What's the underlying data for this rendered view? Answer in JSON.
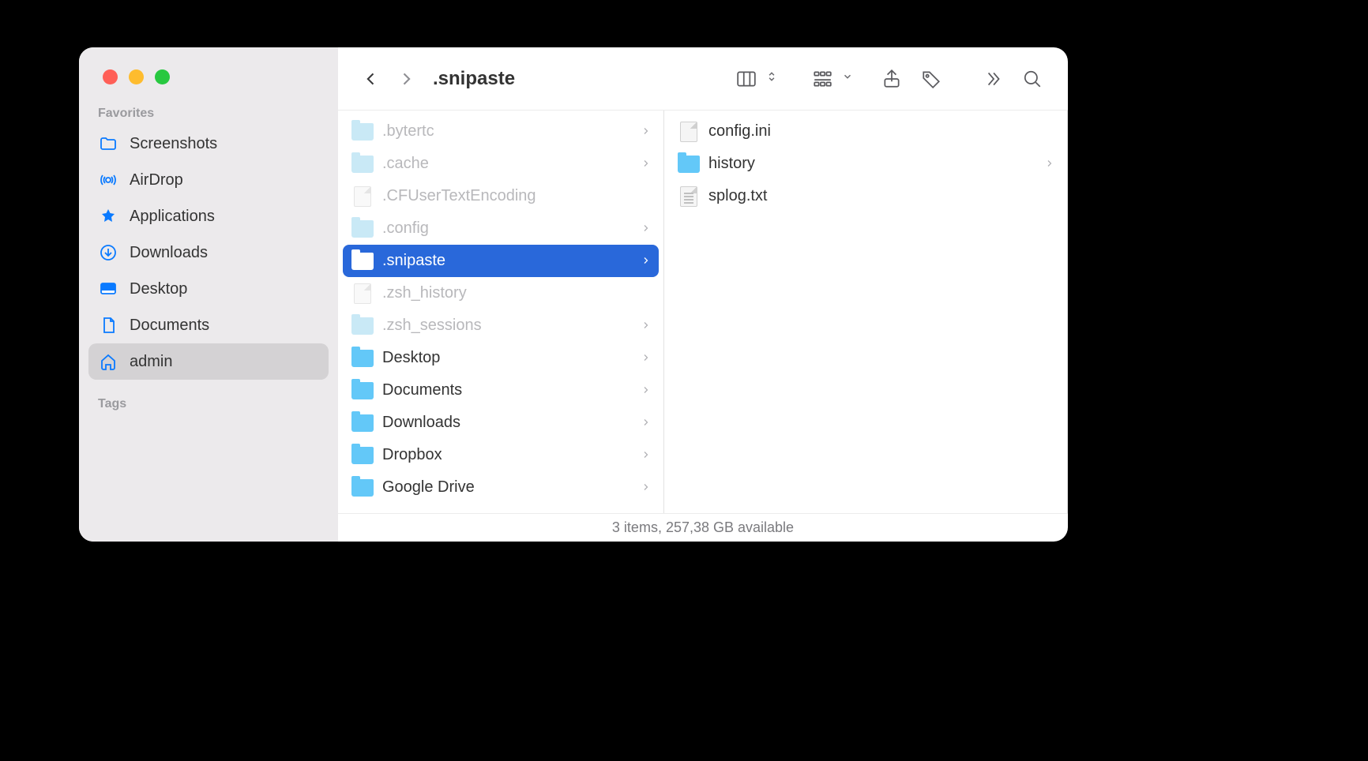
{
  "window": {
    "title": ".snipaste"
  },
  "sidebar": {
    "sections": {
      "favorites_label": "Favorites",
      "tags_label": "Tags"
    },
    "favorites": [
      {
        "label": "Screenshots",
        "icon": "folder-outline",
        "selected": false
      },
      {
        "label": "AirDrop",
        "icon": "airdrop",
        "selected": false
      },
      {
        "label": "Applications",
        "icon": "applications",
        "selected": false
      },
      {
        "label": "Downloads",
        "icon": "download-circle",
        "selected": false
      },
      {
        "label": "Desktop",
        "icon": "desktop",
        "selected": false
      },
      {
        "label": "Documents",
        "icon": "document",
        "selected": false
      },
      {
        "label": "admin",
        "icon": "home",
        "selected": true
      }
    ]
  },
  "column1": [
    {
      "name": ".bytertc",
      "type": "folder",
      "dim": true,
      "arrow": true,
      "selected": false
    },
    {
      "name": ".cache",
      "type": "folder",
      "dim": true,
      "arrow": true,
      "selected": false
    },
    {
      "name": ".CFUserTextEncoding",
      "type": "file",
      "dim": true,
      "arrow": false,
      "selected": false
    },
    {
      "name": ".config",
      "type": "folder",
      "dim": true,
      "arrow": true,
      "selected": false
    },
    {
      "name": ".snipaste",
      "type": "folder",
      "dim": false,
      "arrow": true,
      "selected": true
    },
    {
      "name": ".zsh_history",
      "type": "file",
      "dim": true,
      "arrow": false,
      "selected": false
    },
    {
      "name": ".zsh_sessions",
      "type": "folder",
      "dim": true,
      "arrow": true,
      "selected": false
    },
    {
      "name": "Desktop",
      "type": "folder",
      "dim": false,
      "arrow": true,
      "selected": false
    },
    {
      "name": "Documents",
      "type": "folder",
      "dim": false,
      "arrow": true,
      "selected": false
    },
    {
      "name": "Downloads",
      "type": "folder",
      "dim": false,
      "arrow": true,
      "selected": false
    },
    {
      "name": "Dropbox",
      "type": "folder",
      "dim": false,
      "arrow": true,
      "selected": false
    },
    {
      "name": "Google Drive",
      "type": "folder",
      "dim": false,
      "arrow": true,
      "selected": false
    }
  ],
  "column2": [
    {
      "name": "config.ini",
      "type": "file",
      "arrow": false
    },
    {
      "name": "history",
      "type": "folder",
      "arrow": true
    },
    {
      "name": "splog.txt",
      "type": "file-txt",
      "arrow": false
    }
  ],
  "status": {
    "text": "3 items, 257,38 GB available"
  }
}
